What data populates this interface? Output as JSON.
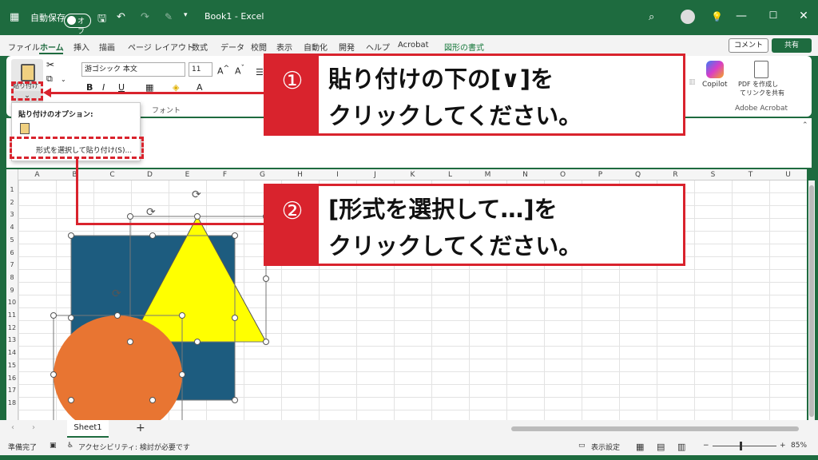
{
  "titlebar": {
    "autosave_label": "自動保存",
    "autosave_state": "オフ",
    "title": "Book1 - Excel"
  },
  "tabs": [
    "ファイル",
    "ホーム",
    "挿入",
    "描画",
    "ページ レイアウト",
    "数式",
    "データ",
    "校閲",
    "表示",
    "自動化",
    "開発",
    "ヘルプ",
    "Acrobat",
    "図形の書式"
  ],
  "active_tab": "ホーム",
  "buttons": {
    "comment": "コメント",
    "share": "共有"
  },
  "ribbon": {
    "paste_label": "貼り付け",
    "font_name": "游ゴシック 本文",
    "font_size": "11",
    "font_group_label": "フォント",
    "copilot": "Copilot",
    "pdf_line1": "PDF を作成し",
    "pdf_line2": "てリンクを共有",
    "acrobat_group": "Adobe Acrobat"
  },
  "paste_menu": {
    "header": "貼り付けのオプション:",
    "item": "形式を選択して貼り付け(S)..."
  },
  "columns": [
    "A",
    "B",
    "C",
    "D",
    "E",
    "F",
    "G",
    "H",
    "I",
    "J",
    "K",
    "L",
    "M",
    "N",
    "O",
    "P",
    "Q",
    "R",
    "S",
    "T",
    "U"
  ],
  "rows": [
    "1",
    "2",
    "3",
    "4",
    "5",
    "6",
    "7",
    "8",
    "9",
    "10",
    "11",
    "12",
    "13",
    "14",
    "15",
    "16",
    "17",
    "18"
  ],
  "sheet": {
    "name": "Sheet1",
    "add": "+"
  },
  "status": {
    "ready": "準備完了",
    "accessibility": "アクセシビリティ: 検討が必要です",
    "display_settings": "表示設定",
    "zoom": "85%"
  },
  "callouts": {
    "one": {
      "num": "①",
      "line1": "貼り付けの下の[∨]を",
      "line2": "クリックしてください。"
    },
    "two": {
      "num": "②",
      "line1": "[形式を選択して…]を",
      "line2": "クリックしてください。"
    }
  },
  "colors": {
    "excel_green": "#1e6b3f",
    "square": "#1d5c7f",
    "triangle": "#ffff00",
    "circle": "#e87532",
    "annotation_red": "#d9232d"
  }
}
